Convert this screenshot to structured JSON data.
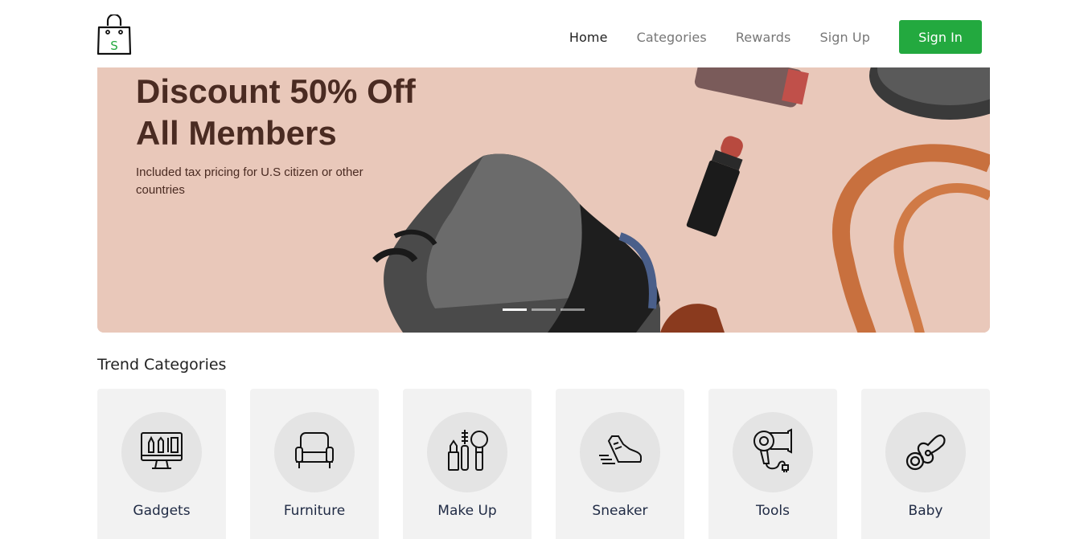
{
  "header": {
    "logo_letter": "S",
    "nav": [
      {
        "label": "Home",
        "active": true
      },
      {
        "label": "Categories",
        "active": false
      },
      {
        "label": "Rewards",
        "active": false
      },
      {
        "label": "Sign Up",
        "active": false
      }
    ],
    "signin_label": "Sign In",
    "brand_color": "#23a93f"
  },
  "hero": {
    "title_line1": "Discount 50% Off",
    "title_line2": "All Members",
    "subtitle": "Included tax pricing for U.S citizen or other countries",
    "slides_total": 3,
    "slide_active": 1,
    "background_color": "#e8c7b8"
  },
  "trend": {
    "title": "Trend Categories",
    "items": [
      {
        "label": "Gadgets",
        "icon": "monitor-icon"
      },
      {
        "label": "Furniture",
        "icon": "armchair-icon"
      },
      {
        "label": "Make Up",
        "icon": "makeup-icon"
      },
      {
        "label": "Sneaker",
        "icon": "sneaker-icon"
      },
      {
        "label": "Tools",
        "icon": "hair-dryer-icon"
      },
      {
        "label": "Baby",
        "icon": "pacifier-icon"
      }
    ]
  }
}
